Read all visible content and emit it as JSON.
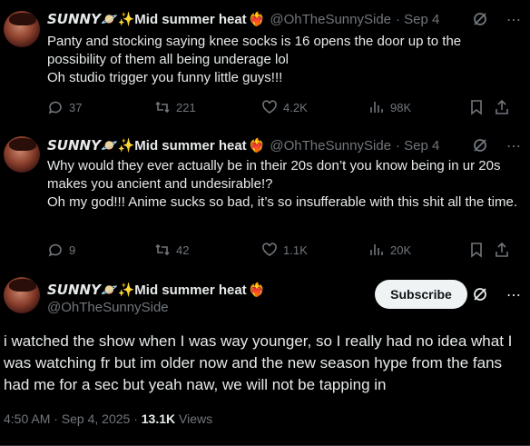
{
  "user": {
    "display_name": "𝙎𝙐𝙉𝙉𝙔🪐✨Mid summer heat",
    "fire_emoji": "❤️‍🔥",
    "handle": "@OhTheSunnySide"
  },
  "tweets": [
    {
      "date": "· Sep 4",
      "lines": [
        "Panty and stocking saying knee socks is 16 opens the door up to the possibility of them all being underage lol",
        "Oh studio trigger you funny little guys!!!"
      ],
      "replies": "37",
      "retweets": "221",
      "likes": "4.2K",
      "views": "98K"
    },
    {
      "date": "· Sep 4",
      "lines": [
        "Why would they ever actually be in their 20s don’t you know being in ur 20s makes you ancient and undesirable!?",
        "Oh my god!!! Anime sucks so bad, it’s so insufferable with this shit all the time."
      ],
      "replies": "9",
      "retweets": "42",
      "likes": "1.1K",
      "views": "20K"
    }
  ],
  "main": {
    "subscribe_label": "Subscribe",
    "text": "i watched the show when I was way younger, so I really had no idea what I was watching fr but im older now and the new season hype from the fans had me for a sec but yeah naw, we will not be tapping in",
    "timestamp": "4:50 AM · Sep 4, 2025 · ",
    "views_count": "13.1K",
    "views_label": " Views"
  },
  "icons": [
    "grok-icon",
    "more-icon",
    "reply-icon",
    "retweet-icon",
    "like-icon",
    "views-icon",
    "bookmark-icon",
    "share-icon"
  ]
}
